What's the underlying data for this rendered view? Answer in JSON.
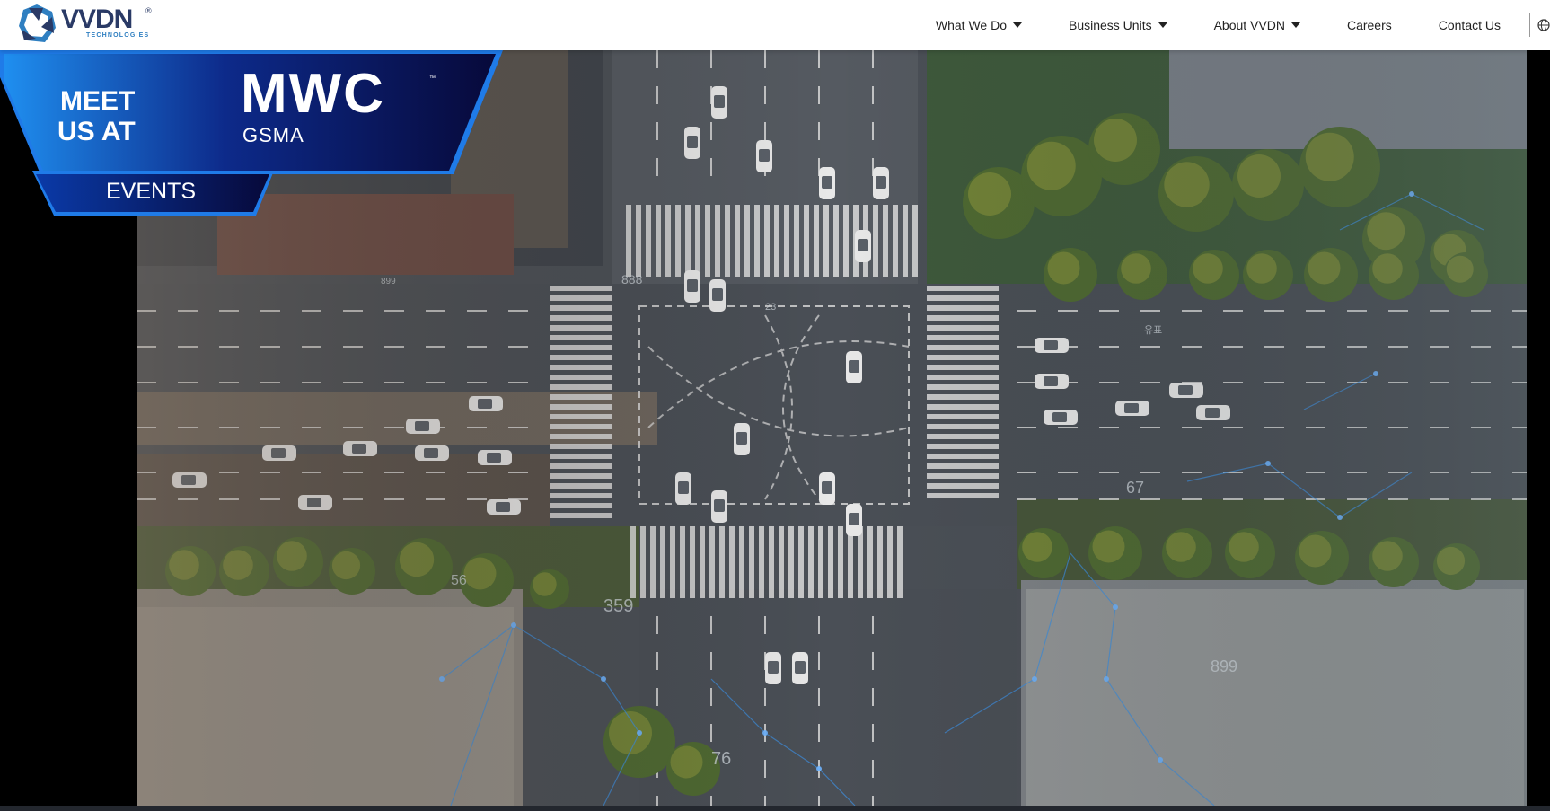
{
  "brand": {
    "name": "VVDN",
    "registered": "®",
    "tagline": "TECHNOLOGIES"
  },
  "nav": {
    "items": [
      {
        "label": "What We Do",
        "dropdown": true
      },
      {
        "label": "Business Units",
        "dropdown": true
      },
      {
        "label": "About VVDN",
        "dropdown": true
      },
      {
        "label": "Careers",
        "dropdown": false
      },
      {
        "label": "Contact Us",
        "dropdown": false
      }
    ],
    "language_icon": "globe-icon"
  },
  "banner": {
    "line1": "MEET",
    "line2": "US AT",
    "event_name": "MWC",
    "trademark": "™",
    "organizer": "GSMA",
    "cta": "EVENTS"
  },
  "scene": {
    "overlay_numbers": [
      "23",
      "67",
      "56",
      "359",
      "899",
      "76",
      "888",
      "899"
    ],
    "road_marking": "유표"
  },
  "colors": {
    "nav_text": "#222222",
    "brand_navy": "#2a3a66",
    "brand_blue": "#2f7fc1",
    "banner_dark": "#0a0f3a",
    "banner_accent": "#1a78e6",
    "network_line": "#3d8fe0"
  }
}
